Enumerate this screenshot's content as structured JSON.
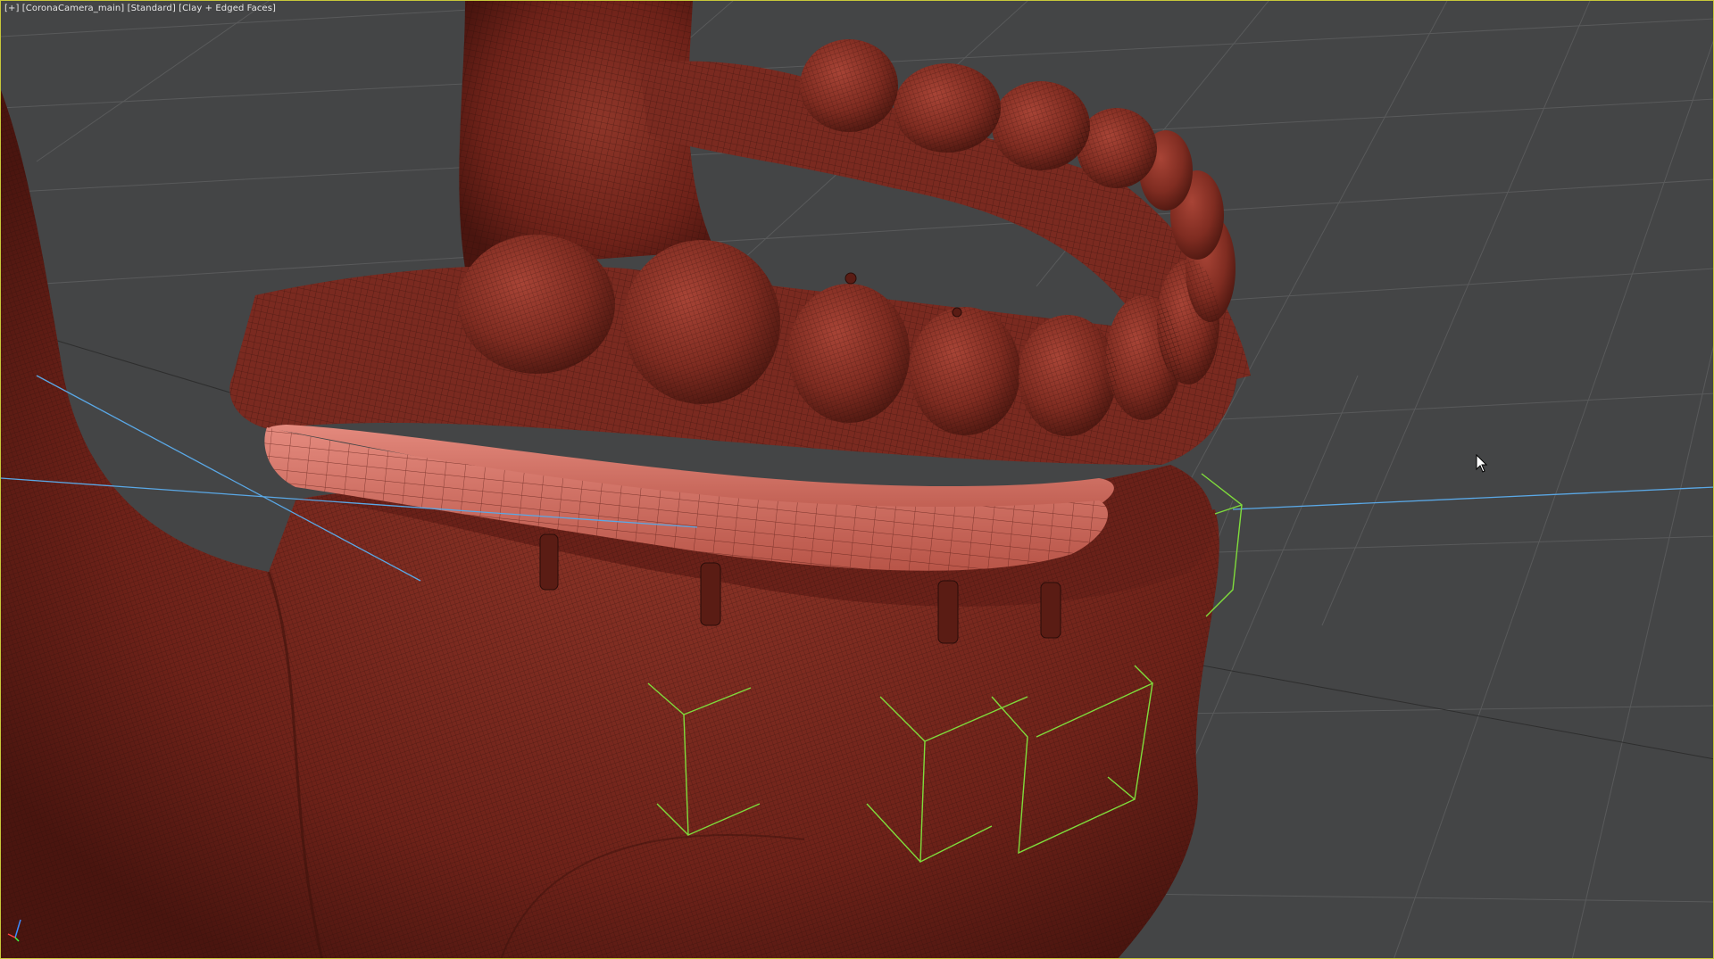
{
  "viewport": {
    "label_parts": [
      {
        "text": "[+]",
        "role": "viewport-menu"
      },
      {
        "text": "[CoronaCamera_main]",
        "role": "point-of-view"
      },
      {
        "text": "[Standard]",
        "role": "viewport-shading-profile"
      },
      {
        "text": "[Clay + Edged Faces]",
        "role": "display-style"
      }
    ],
    "border_color": "#c8c83a",
    "background_color": "#444546"
  },
  "scene": {
    "objects": [
      {
        "name": "mandible",
        "color": "#7a2a20"
      },
      {
        "name": "upper-denture",
        "color": "#8a3328"
      },
      {
        "name": "maxilla-bone",
        "color": "#7d2c21"
      },
      {
        "name": "gum-bar",
        "color": "#d26a5e"
      },
      {
        "name": "implant-abutments",
        "count": 4
      },
      {
        "name": "lights",
        "count": 4,
        "color": "#7fdc3c"
      },
      {
        "name": "camera-target-line",
        "color": "#5aa8e6"
      }
    ]
  }
}
